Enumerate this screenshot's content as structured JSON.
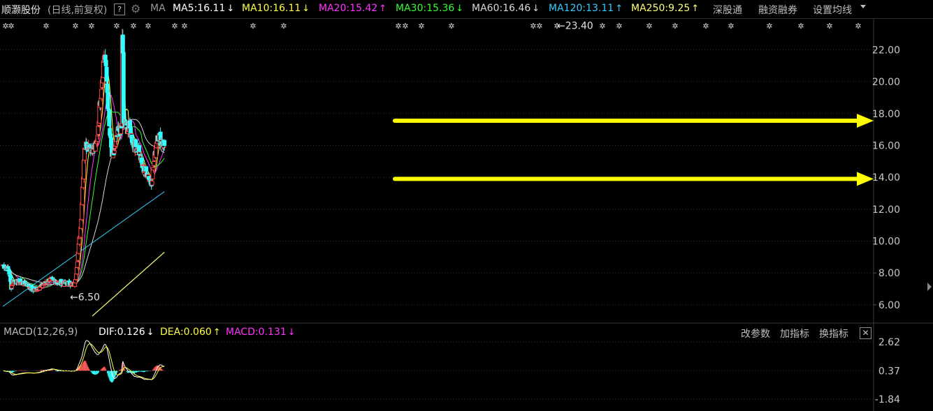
{
  "header": {
    "stock_name": "顺灏股份",
    "period_label": "(日线,前复权)",
    "help_label": "?",
    "ma_label": "MA",
    "ma_items": [
      {
        "label": "MA5:16.11",
        "arrow": "↓",
        "color": "#ffffff"
      },
      {
        "label": "MA10:16.11",
        "arrow": "↓",
        "color": "#ffff3c"
      },
      {
        "label": "MA20:15.42",
        "arrow": "↑",
        "color": "#ff33ff"
      },
      {
        "label": "MA30:15.36",
        "arrow": "↓",
        "color": "#33ff33"
      },
      {
        "label": "MA60:16.46",
        "arrow": "↓",
        "color": "#d8d8d8"
      },
      {
        "label": "MA120:13.11",
        "arrow": "↑",
        "color": "#33ccff"
      },
      {
        "label": "MA250:9.25",
        "arrow": "↑",
        "color": "#ffff7a"
      }
    ],
    "menu": [
      "深股通",
      "融资融券",
      "设置均线"
    ]
  },
  "macd_panel": {
    "title": "MACD(12,26,9)",
    "items": [
      {
        "label": "DIF:0.126",
        "arrow": "↓",
        "color": "#ffffff"
      },
      {
        "label": "DEA:0.060",
        "arrow": "↑",
        "color": "#ffff3c"
      },
      {
        "label": "MACD:0.131",
        "arrow": "↓",
        "color": "#ff33ff"
      }
    ],
    "buttons": [
      "改参数",
      "加指标",
      "换指标"
    ],
    "close_label": "✕"
  },
  "chart_data": [
    {
      "type": "candlestick",
      "y_ticks": [
        "22.00",
        "20.00",
        "18.00",
        "16.00",
        "14.00",
        "12.00",
        "10.00",
        "8.00",
        "6.00"
      ],
      "ylim": [
        4.9,
        23.9
      ],
      "annotations": [
        {
          "text": "←23.40",
          "value": 23.4
        },
        {
          "text": "←6.50",
          "value": 6.5
        }
      ],
      "horizontal_markers": [
        17.55,
        13.9
      ],
      "colors": {
        "up": "#ff4a4a",
        "down": "#33ffff",
        "marker": "#ffff00"
      }
    },
    {
      "type": "line",
      "name": "MACD",
      "y_ticks": [
        "2.62",
        "0.37",
        "-1.84"
      ],
      "ylim": [
        -1.84,
        2.62
      ]
    }
  ]
}
